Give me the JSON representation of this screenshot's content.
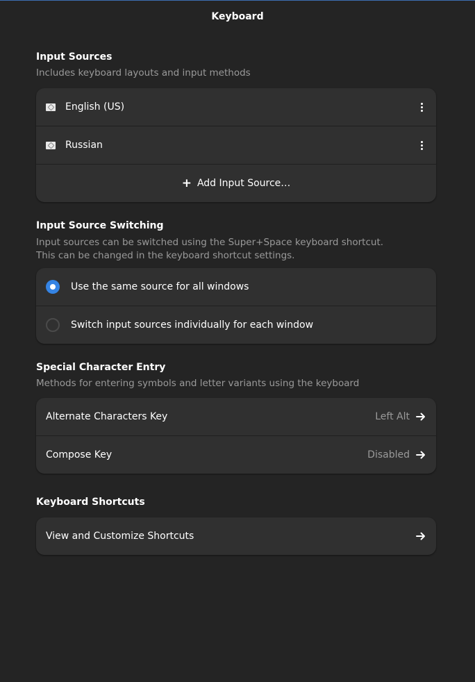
{
  "window": {
    "title": "Keyboard"
  },
  "input_sources": {
    "title": "Input Sources",
    "description": "Includes keyboard layouts and input methods",
    "items": [
      {
        "label": "English (US)",
        "icon": "keyboard-flag-icon"
      },
      {
        "label": "Russian",
        "icon": "keyboard-flag-icon"
      }
    ],
    "add_label": "Add Input Source…"
  },
  "switching": {
    "title": "Input Source Switching",
    "description_line1": "Input sources can be switched using the Super+Space keyboard shortcut.",
    "description_line2": "This can be changed in the keyboard shortcut settings.",
    "options": [
      {
        "label": "Use the same source for all windows",
        "selected": true
      },
      {
        "label": "Switch input sources individually for each window",
        "selected": false
      }
    ]
  },
  "special": {
    "title": "Special Character Entry",
    "description": "Methods for entering symbols and letter variants using the keyboard",
    "rows": [
      {
        "label": "Alternate Characters Key",
        "value": "Left Alt"
      },
      {
        "label": "Compose Key",
        "value": "Disabled"
      }
    ]
  },
  "shortcuts": {
    "title": "Keyboard Shortcuts",
    "row_label": "View and Customize Shortcuts"
  },
  "colors": {
    "background": "#242424",
    "card": "#303030",
    "accent": "#3584e4",
    "dim_text": "#9a9a9a"
  }
}
